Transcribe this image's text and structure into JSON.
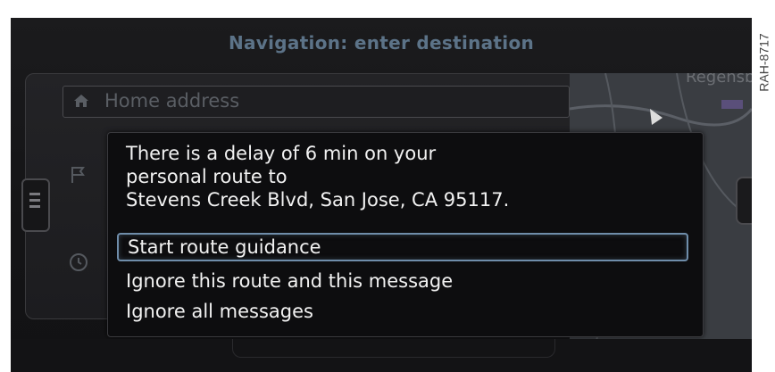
{
  "screen": {
    "title": "Navigation: enter destination"
  },
  "list": {
    "home_address": "Home address",
    "home_icon": "home-icon"
  },
  "map": {
    "label": "Regensbu"
  },
  "dialog": {
    "message_lines": [
      "There is a delay of 6 min on your",
      "personal route to",
      "Stevens Creek Blvd, San Jose, CA 95117."
    ],
    "options": [
      "Start route guidance",
      "Ignore this route and this message",
      "Ignore all messages"
    ],
    "selected_option": "Start route guidance"
  },
  "watermark": "RAH-8717",
  "colors": {
    "title": "#5c7388",
    "selection_border": "#6f8daa",
    "text": "#f2f2f2"
  }
}
